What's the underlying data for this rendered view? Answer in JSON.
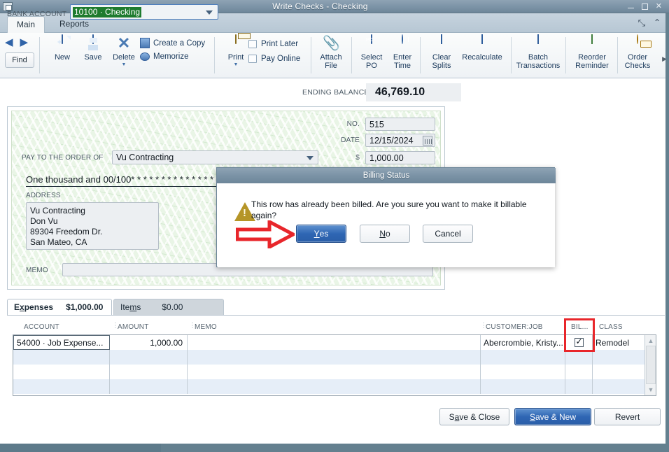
{
  "window": {
    "title": "Write Checks - Checking",
    "minimize": "minimize-icon",
    "maximize": "maximize-icon",
    "close": "✕"
  },
  "ribbon": {
    "tabs": [
      {
        "label": "Main",
        "active": true
      },
      {
        "label": "Reports",
        "active": false
      }
    ],
    "expand_icon": "⤡",
    "collapse_icon": "⌃"
  },
  "toolbar": {
    "nav_back": "◀",
    "nav_forward": "▶",
    "find_label": "Find",
    "new_label": "New",
    "save_label": "Save",
    "delete_label": "Delete",
    "delete_caret": "▼",
    "create_copy_label": "Create a Copy",
    "memorize_label": "Memorize",
    "print_label": "Print",
    "print_caret": "▼",
    "print_later_label": "Print Later",
    "pay_online_label": "Pay Online",
    "attach_file_line1": "Attach",
    "attach_file_line2": "File",
    "select_po_line1": "Select",
    "select_po_line2": "PO",
    "enter_time_line1": "Enter",
    "enter_time_line2": "Time",
    "clear_splits_line1": "Clear",
    "clear_splits_line2": "Splits",
    "recalculate_label": "Recalculate",
    "batch_line1": "Batch",
    "batch_line2": "Transactions",
    "reorder_line1": "Reorder",
    "reorder_line2": "Reminder",
    "order_checks_line1": "Order",
    "order_checks_line2": "Checks",
    "scroll_right": "▶"
  },
  "bank": {
    "label": "BANK ACCOUNT",
    "value": "10100 · Checking",
    "ending_balance_label": "ENDING BALANCE",
    "ending_balance_value": "46,769.10"
  },
  "check": {
    "no_label": "NO.",
    "no_value": "515",
    "date_label": "DATE",
    "date_value": "12/15/2024",
    "dollar_label": "$",
    "amount_value": "1,000.00",
    "payto_label": "PAY TO THE ORDER OF",
    "payto_value": "Vu Contracting",
    "amount_words": "One thousand  and 00/100* * * * * * * * * * * * * * * * * * * * * * * * * * * * * * * * * * * * * * * * * * * * * *",
    "address_label": "ADDRESS",
    "address_value": "Vu Contracting\nDon Vu\n89304 Freedom Dr.\nSan Mateo, CA",
    "memo_label": "MEMO",
    "memo_value": ""
  },
  "sheet_tabs": {
    "expenses_label": "Expenses",
    "expenses_amount": "$1,000.00",
    "items_label": "Items",
    "items_amount": "$0.00"
  },
  "grid": {
    "columns": [
      "ACCOUNT",
      "AMOUNT",
      "MEMO",
      "CUSTOMER:JOB",
      "BIL...",
      "CLASS"
    ],
    "rows": [
      {
        "account": "54000 · Job Expense...",
        "amount": "1,000.00",
        "memo": "",
        "customer": "Abercrombie, Kristy...",
        "billable": true,
        "class": "Remodel"
      },
      {
        "account": "",
        "amount": "",
        "memo": "",
        "customer": "",
        "billable": false,
        "class": ""
      },
      {
        "account": "",
        "amount": "",
        "memo": "",
        "customer": "",
        "billable": false,
        "class": ""
      },
      {
        "account": "",
        "amount": "",
        "memo": "",
        "customer": "",
        "billable": false,
        "class": ""
      }
    ],
    "scroll_up": "▲",
    "scroll_down": "▼",
    "highlight_color": "#e8262b"
  },
  "footer": {
    "save_close": "Save & Close",
    "save_new": "Save & New",
    "revert": "Revert"
  },
  "dialog": {
    "title": "Billing Status",
    "message": "This row has already been billed. Are you sure you want to make it billable again?",
    "warning_icon": "warning-triangle-icon",
    "yes_label": "Yes",
    "no_label": "No",
    "cancel_label": "Cancel",
    "pointer": "red-arrow-annotation",
    "accent_color": "#2f66b4"
  }
}
